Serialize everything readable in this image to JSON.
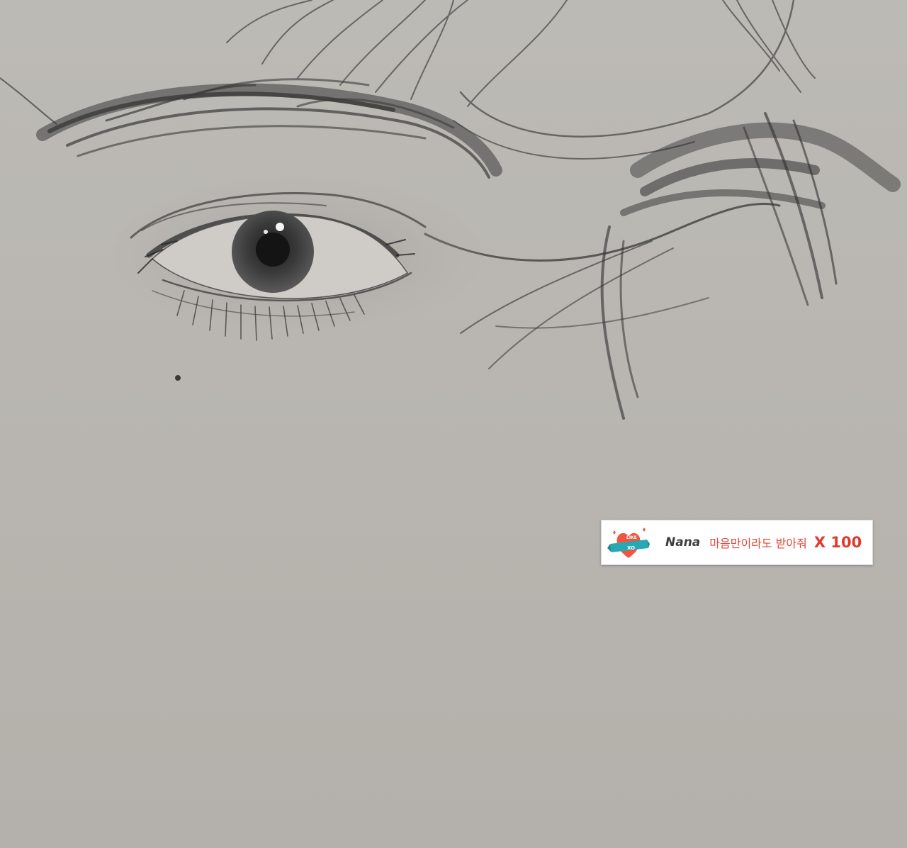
{
  "gift_banner": {
    "badge_text_top": "LIKE",
    "badge_text_bottom": "XO",
    "sender": "Nana",
    "message": "마음만이라도 받아줘",
    "count": "X 100"
  },
  "colors": {
    "paper": "#b9b6b1",
    "graphite": "#2e2e2e",
    "message_red": "#e0483a",
    "count_red": "#e2392a",
    "badge_heart": "#f0563f",
    "badge_ribbon": "#27a8b5"
  },
  "icons": {
    "badge": "heart-ribbon-icon"
  }
}
